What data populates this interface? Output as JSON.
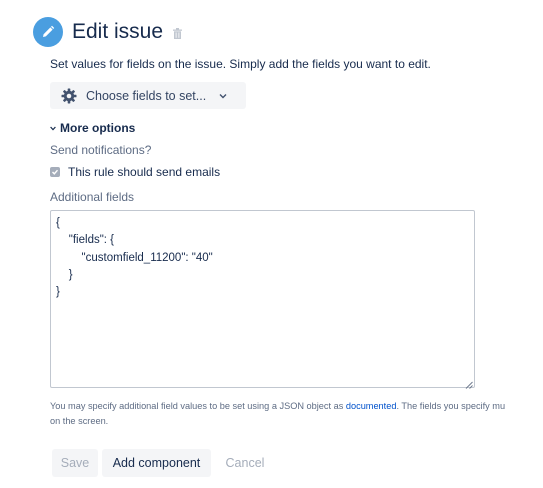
{
  "header": {
    "title": "Edit issue",
    "icon": "pencil-icon",
    "delete_icon": "trash-icon",
    "accent_color": "#4a9ee0"
  },
  "description": "Set values for fields on the issue. Simply add the fields you want to edit.",
  "choose_fields": {
    "label": "Choose fields to set...",
    "icon": "gear-icon",
    "dropdown_icon": "chevron-down-icon"
  },
  "more_options": {
    "label": "More options",
    "icon": "chevron-down-icon"
  },
  "notifications": {
    "label": "Send notifications?",
    "checkbox_label": "This rule should send emails",
    "checked": true
  },
  "additional_fields": {
    "label": "Additional fields",
    "json_lines": [
      "{",
      "    \"fields\": {",
      "        \"customfield_11200\": \"40\"",
      "    }",
      "}"
    ]
  },
  "help": {
    "before_link": "You may specify additional field values to be set using a JSON object as ",
    "link_text": "documented",
    "after_link": ". The fields you specify mu",
    "line2": "on the screen.",
    "link_color": "#0052cc"
  },
  "footer": {
    "save_label": "Save",
    "add_label": "Add component",
    "cancel_label": "Cancel"
  }
}
